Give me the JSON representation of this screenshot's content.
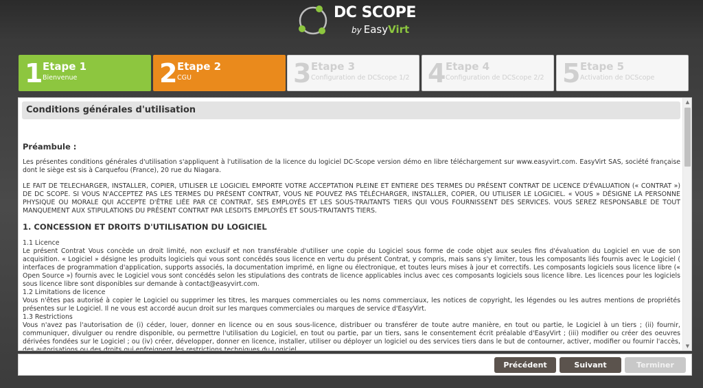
{
  "logo": {
    "brand": "DC SCOPE",
    "by": "by",
    "easy": "Easy",
    "virt": "Virt"
  },
  "steps": [
    {
      "num": "1",
      "title": "Etape 1",
      "sub": "Bienvenue",
      "state": "done",
      "color": "#8dc63f"
    },
    {
      "num": "2",
      "title": "Etape 2",
      "sub": "CGU",
      "state": "current",
      "color": "#ea8a1c"
    },
    {
      "num": "3",
      "title": "Etape 3",
      "sub": "Configuration de DCScope 1/2",
      "state": "pending"
    },
    {
      "num": "4",
      "title": "Etape 4",
      "sub": "Configuration de DCScope 2/2",
      "state": "pending"
    },
    {
      "num": "5",
      "title": "Etape 5",
      "sub": "Activation de DCScope",
      "state": "pending"
    }
  ],
  "panel": {
    "header": "Conditions générales d'utilisation",
    "preamble_title": "Préambule :",
    "para1": "Les présentes conditions générales d'utilisation s'appliquent à l'utilisation de la licence du logiciel DC-Scope version démo en libre téléchargement sur www.easyvirt.com. EasyVirt SAS, société française dont le siège est sis à Carquefou (France), 20 rue du Niagara.",
    "para2": "LE FAIT DE TELECHARGER, INSTALLER, COPIER, UTILISER LE LOGICIEL EMPORTE VOTRE ACCEPTATION PLEINE ET ENTIERE DES TERMES DU PRÉSENT CONTRAT DE LICENCE D'ÉVALUATION (« CONTRAT ») DE DC SCOPE. SI VOUS N'ACCEPTEZ PAS LES TERMES DU PRÉSENT CONTRAT, VOUS NE POUVEZ PAS TÉLÉCHARGER, INSTALLER, COPIER, OU UTILISER LE LOGICIEL. « VOUS » DÉSIGNE LA PERSONNE PHYSIQUE OU MORALE QUI ACCEPTE D'ÊTRE LIÉE PAR CE CONTRAT, SES EMPLOYÉS ET LES SOUS-TRAITANTS TIERS QUI VOUS FOURNISSENT DES SERVICES. VOUS SEREZ RESPONSABLE DE TOUT MANQUEMENT AUX STIPULATIONS DU PRÉSENT CONTRAT PAR LESDITS EMPLOYÉS ET SOUS-TRAITANTS TIERS.",
    "section1_title": "1. CONCESSION ET DROITS D'UTILISATION DU LOGICIEL",
    "s11_title": "1.1 Licence",
    "s11_text": "Le présent Contrat Vous concède un droit limité, non exclusif et non transférable d'utiliser une copie du Logiciel sous forme de code objet aux seules fins d'évaluation du Logiciel en vue de son acquisition. « Logiciel » désigne les produits logiciels qui vous sont concédés sous licence en vertu du présent Contrat, y compris, mais sans s'y limiter, tous les composants liés fournis avec le Logiciel ( interfaces de programmation d'application, supports associés, la documentation imprimé, en ligne ou électronique, et toutes leurs mises à jour et correctifs. Les composants logiciels sous licence libre (« Open Source ») fournis avec le Logiciel vous sont concédés selon les stipulations des contrats de licence applicables inclus avec ces composants logiciels sous licence libre. Les licences pour les logiciels sous licence libre sont disponibles sur demande à contact@easyvirt.com.",
    "s12_title": "1.2 Limitations de licence",
    "s12_text": "Vous n'êtes pas autorisé à copier le Logiciel ou supprimer les titres, les marques commerciales ou les noms commerciaux, les notices de copyright, les légendes ou les autres mentions de propriétés présentes sur le Logiciel. Il ne vous est accordé aucun droit sur les marques commerciales ou marques de service d'EasyVirt.",
    "s13_title": "1.3 Restrictions",
    "s13_text": "Vous n'avez pas l'autorisation de (i) céder, louer, donner en licence ou en sous sous-licence, distribuer ou transférer de toute autre manière, en tout ou partie, le Logiciel à un tiers ; (ii) fournir, communiquer, divulguer ou rendre disponible, ou permettre l'utilisation du Logiciel, en tout ou partie, par un tiers, sans le consentement écrit préalable d'EasyVirt ; (iii) modifier ou créer des oeuvres dérivées fondées sur le Logiciel ; ou (iv) créer, développer, donner en licence, installer, utiliser ou déployer un logiciel ou des services tiers dans le but de contourner, activer, modifier ou fournir l'accès, des autorisations ou des droits qui enfreignent les restrictions techniques du Logiciel."
  },
  "buttons": {
    "prev": "Précédent",
    "next": "Suivant",
    "finish": "Terminer"
  },
  "colors": {
    "green": "#8dc63f",
    "orange": "#ea8a1c",
    "button": "#5b534d"
  }
}
